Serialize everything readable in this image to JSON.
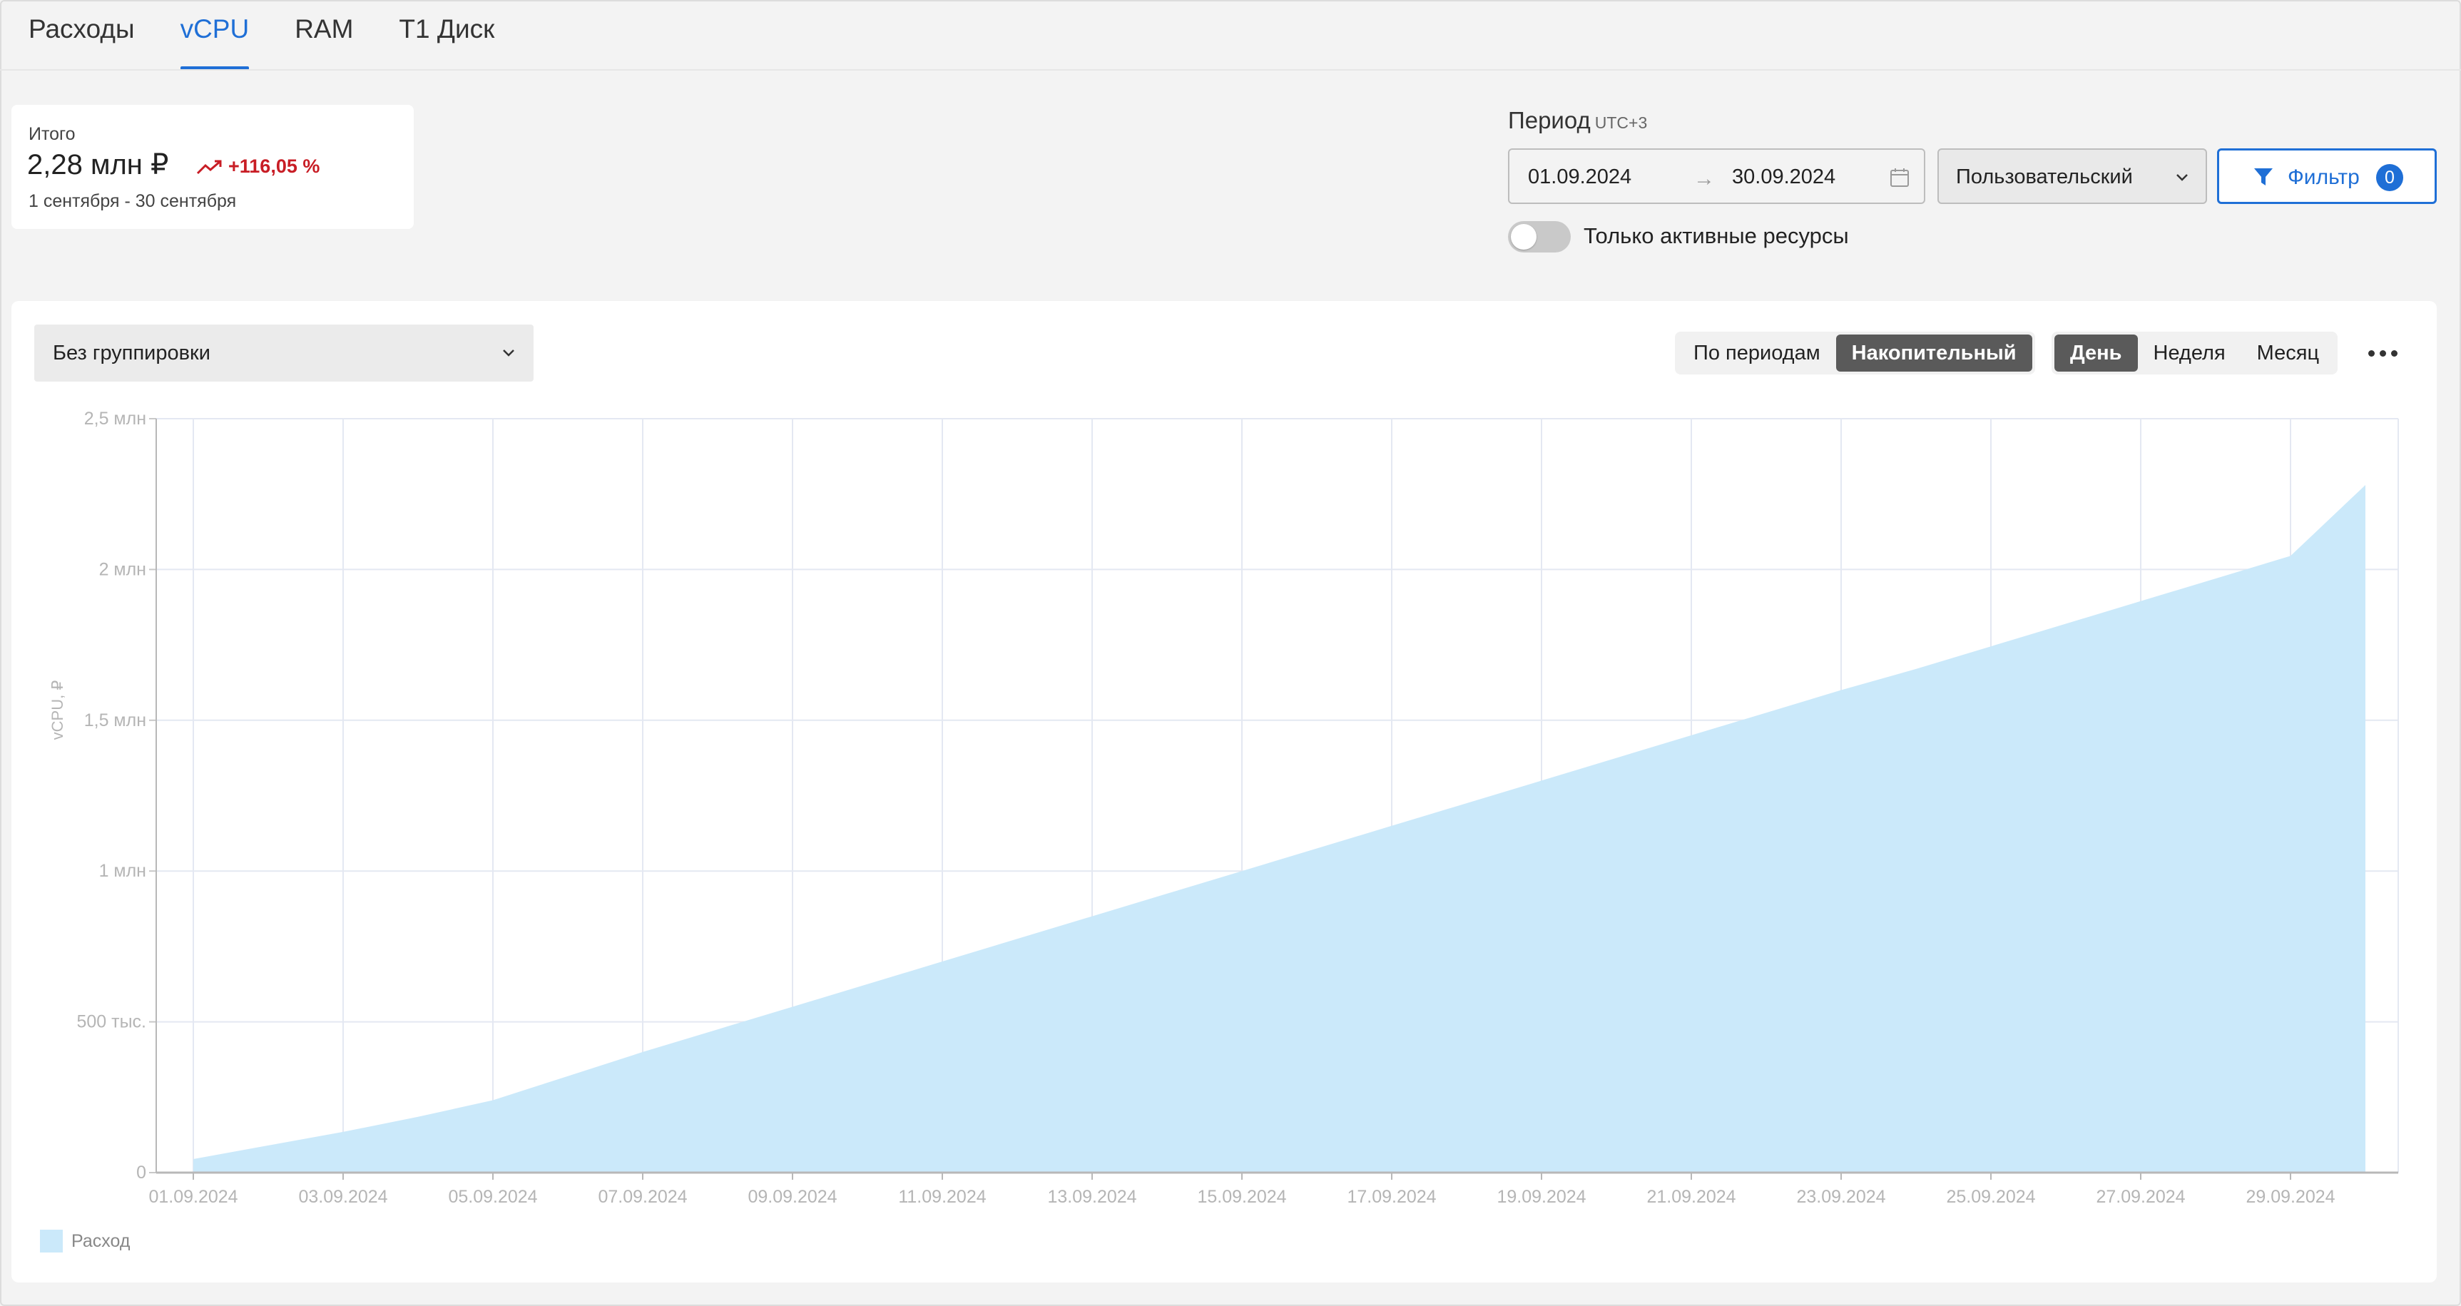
{
  "tabs": [
    {
      "label": "Расходы",
      "active": false
    },
    {
      "label": "vCPU",
      "active": true
    },
    {
      "label": "RAM",
      "active": false
    },
    {
      "label": "Т1 Диск",
      "active": false
    }
  ],
  "summary": {
    "label": "Итого",
    "value": "2,28 млн ₽",
    "change": "+116,05 %",
    "period": "1 сентября - 30 сентября"
  },
  "period": {
    "label": "Период",
    "timezone": "UTC+3",
    "from": "01.09.2024",
    "to": "30.09.2024",
    "preset": "Пользовательский"
  },
  "filter": {
    "label": "Фильтр",
    "count": "0"
  },
  "active_toggle": {
    "label": "Только активные ресурсы",
    "on": false
  },
  "grouping": {
    "selected": "Без группировки"
  },
  "mode_tabs": [
    {
      "label": "По периодам",
      "active": false
    },
    {
      "label": "Накопительный",
      "active": true
    }
  ],
  "step_tabs": [
    {
      "label": "День",
      "active": true
    },
    {
      "label": "Неделя",
      "active": false
    },
    {
      "label": "Месяц",
      "active": false
    }
  ],
  "colors": {
    "accent": "#1f6fd6",
    "area": "#cbe9fa",
    "negative": "#c81d25"
  },
  "chart_data": {
    "type": "area",
    "ylabel": "vCPU, ₽",
    "ylim": [
      0,
      2500000
    ],
    "yticks": [
      {
        "value": 0,
        "label": "0"
      },
      {
        "value": 500000,
        "label": "500 тыс."
      },
      {
        "value": 1000000,
        "label": "1 млн"
      },
      {
        "value": 1500000,
        "label": "1,5 млн"
      },
      {
        "value": 2000000,
        "label": "2 млн"
      },
      {
        "value": 2500000,
        "label": "2,5 млн"
      }
    ],
    "xtick_labels": [
      "01.09.2024",
      "03.09.2024",
      "05.09.2024",
      "07.09.2024",
      "09.09.2024",
      "11.09.2024",
      "13.09.2024",
      "15.09.2024",
      "17.09.2024",
      "19.09.2024",
      "21.09.2024",
      "23.09.2024",
      "25.09.2024",
      "27.09.2024",
      "29.09.2024"
    ],
    "grid": true,
    "legend": "bottom-left",
    "series": [
      {
        "name": "Расход",
        "x": [
          "01.09.2024",
          "02.09.2024",
          "03.09.2024",
          "04.09.2024",
          "05.09.2024",
          "06.09.2024",
          "07.09.2024",
          "08.09.2024",
          "09.09.2024",
          "10.09.2024",
          "11.09.2024",
          "12.09.2024",
          "13.09.2024",
          "14.09.2024",
          "15.09.2024",
          "16.09.2024",
          "17.09.2024",
          "18.09.2024",
          "19.09.2024",
          "20.09.2024",
          "21.09.2024",
          "22.09.2024",
          "23.09.2024",
          "24.09.2024",
          "25.09.2024",
          "26.09.2024",
          "27.09.2024",
          "28.09.2024",
          "29.09.2024",
          "30.09.2024"
        ],
        "values": [
          45000,
          90000,
          135000,
          185000,
          240000,
          320000,
          400000,
          475000,
          550000,
          625000,
          700000,
          775000,
          850000,
          925000,
          1000000,
          1075000,
          1150000,
          1225000,
          1300000,
          1375000,
          1450000,
          1525000,
          1600000,
          1670000,
          1745000,
          1820000,
          1895000,
          1970000,
          2045000,
          2280000
        ]
      }
    ]
  }
}
